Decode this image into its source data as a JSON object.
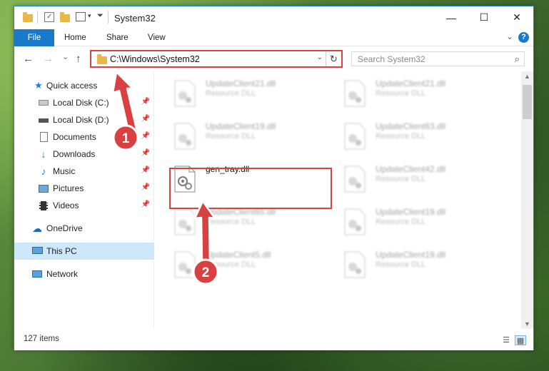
{
  "window": {
    "title": "System32",
    "controls": {
      "minimize": "—",
      "maximize": "☐",
      "close": "✕"
    }
  },
  "ribbon": {
    "tabs": [
      "File",
      "Home",
      "Share",
      "View"
    ],
    "help": "?",
    "collapse": "⌄"
  },
  "address": {
    "path": "C:\\Windows\\System32",
    "dropdown": "⌄",
    "refresh": "↻",
    "search_placeholder": "Search System32",
    "back": "←",
    "forward": "→",
    "recent": "⌄",
    "up": "↑"
  },
  "nav": {
    "quick_access": "Quick access",
    "items": [
      {
        "label": "Local Disk (C:)",
        "icon": "drive-icon",
        "pinned": true
      },
      {
        "label": "Local Disk (D:)",
        "icon": "drive-icon",
        "pinned": true
      },
      {
        "label": "Documents",
        "icon": "documents-icon",
        "pinned": true
      },
      {
        "label": "Downloads",
        "icon": "downloads-icon",
        "pinned": true
      },
      {
        "label": "Music",
        "icon": "music-icon",
        "pinned": true
      },
      {
        "label": "Pictures",
        "icon": "pictures-icon",
        "pinned": true
      },
      {
        "label": "Videos",
        "icon": "videos-icon",
        "pinned": true
      }
    ],
    "onedrive": "OneDrive",
    "this_pc": "This PC",
    "network": "Network"
  },
  "files": {
    "left": [
      {
        "name": "UpdateClient21.dll",
        "type": "Resource DLL"
      },
      {
        "name": "UpdateClient19.dll",
        "type": "Resource DLL"
      },
      {
        "name": "gen_tray.dll",
        "type": ""
      },
      {
        "name": "UpdateClient65.dll",
        "type": "Resource DLL"
      },
      {
        "name": "UpdateClient5.dll",
        "type": "Resource DLL"
      }
    ],
    "right": [
      {
        "name": "UpdateClient21.dll",
        "type": "Resource DLL"
      },
      {
        "name": "UpdateClient63.dll",
        "type": "Resource DLL"
      },
      {
        "name": "UpdateClient42.dll",
        "type": "Resource DLL"
      },
      {
        "name": "UpdateClient19.dll",
        "type": "Resource DLL"
      },
      {
        "name": "UpdateClient19.dll",
        "type": "Resource DLL"
      }
    ]
  },
  "status": {
    "count": "127 items"
  },
  "annotations": {
    "step1": "1",
    "step2": "2",
    "color": "#d94040"
  }
}
